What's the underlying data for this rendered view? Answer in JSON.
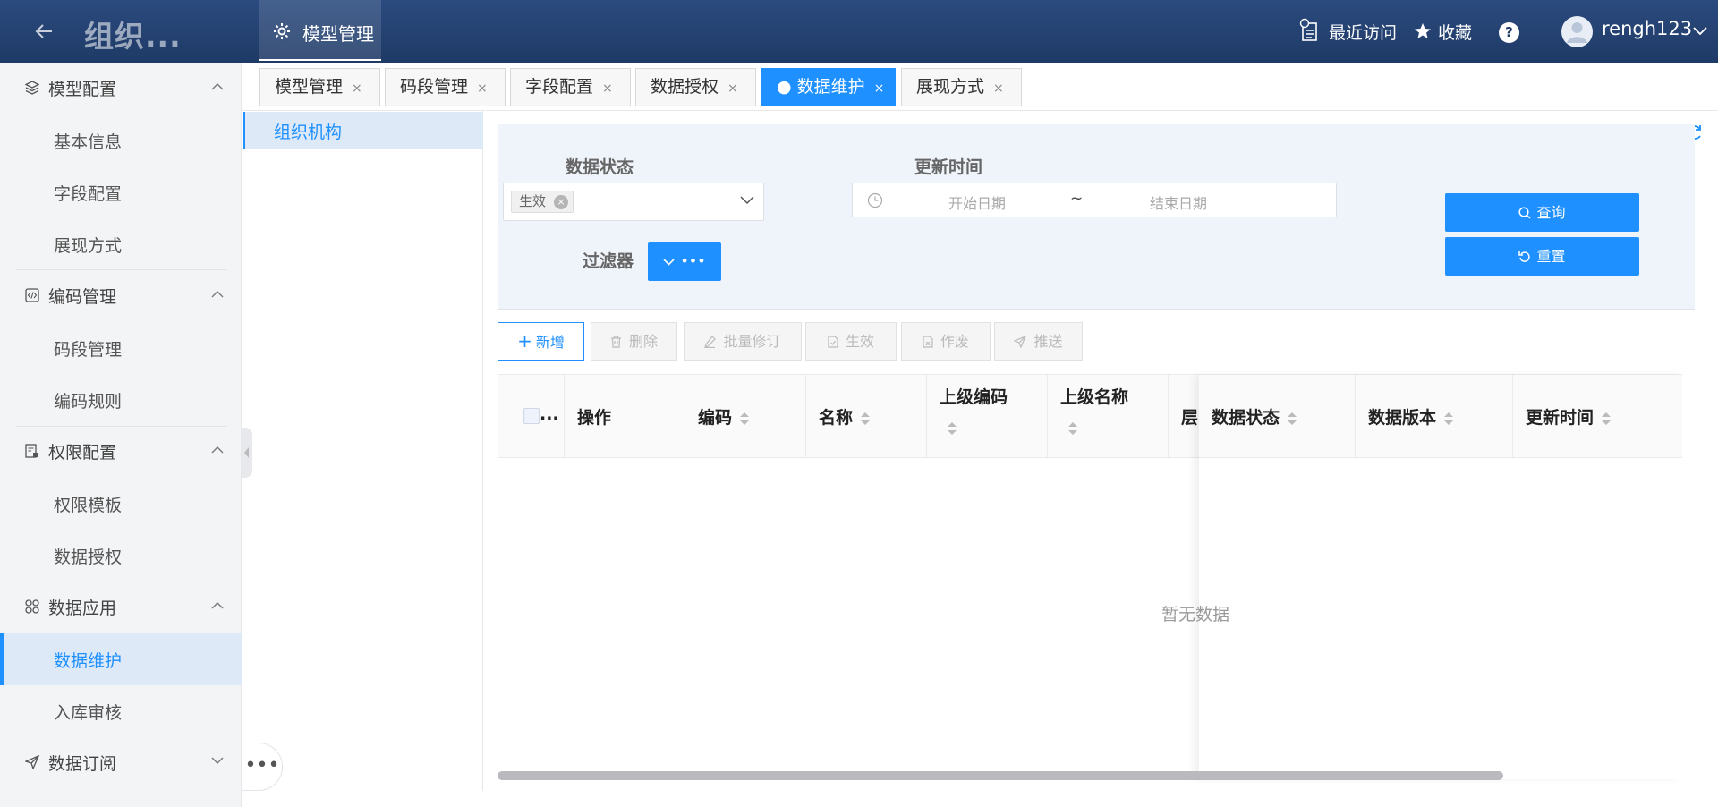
{
  "header": {
    "org_title": "组织...",
    "module_tab": "模型管理",
    "recent": "最近访问",
    "favorites": "收藏",
    "help": "?",
    "username": "rengh123"
  },
  "sidebar": {
    "groups": [
      {
        "label": "模型配置",
        "items": [
          "基本信息",
          "字段配置",
          "展现方式"
        ]
      },
      {
        "label": "编码管理",
        "items": [
          "码段管理",
          "编码规则"
        ]
      },
      {
        "label": "权限配置",
        "items": [
          "权限模板",
          "数据授权"
        ]
      },
      {
        "label": "数据应用",
        "items": [
          "数据维护",
          "入库审核"
        ]
      },
      {
        "label": "数据订阅",
        "items": []
      }
    ],
    "active_item": "数据维护",
    "more": "•••"
  },
  "tabs": [
    {
      "label": "模型管理",
      "active": false
    },
    {
      "label": "码段管理",
      "active": false
    },
    {
      "label": "字段配置",
      "active": false
    },
    {
      "label": "数据授权",
      "active": false
    },
    {
      "label": "● 数据维护",
      "active": true
    },
    {
      "label": "展现方式",
      "active": false
    }
  ],
  "tab_close": "×",
  "tree": {
    "node": "组织机构"
  },
  "filter": {
    "status_label": "数据状态",
    "status_value": "生效",
    "chip_close": "×",
    "update_label": "更新时间",
    "start_placeholder": "开始日期",
    "range_separator": "~",
    "end_placeholder": "结束日期",
    "filter_label": "过滤器",
    "filter_button": "•••",
    "query": "查询",
    "reset": "重置"
  },
  "toolbar": {
    "add": "新增",
    "delete": "删除",
    "batch_edit": "批量修订",
    "activate": "生效",
    "void": "作废",
    "push": "推送"
  },
  "table": {
    "select_col": "...",
    "columns": [
      "操作",
      "编码",
      "名称",
      "上级编码",
      "上级名称",
      "层"
    ],
    "fixed_columns": [
      "数据状态",
      "数据版本",
      "更新时间"
    ],
    "empty_text": "暂无数据"
  },
  "colors": {
    "primary": "#1e90ff",
    "header_bg": "#1e3a66",
    "filter_bg": "#eff3fa"
  }
}
